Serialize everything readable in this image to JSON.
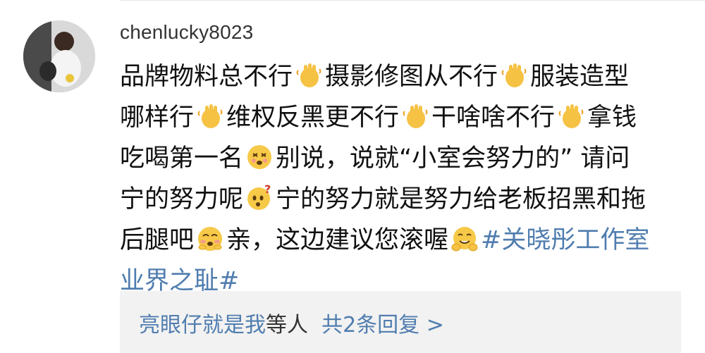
{
  "comment": {
    "username": "chenlucky8023",
    "lines": [
      [
        "品牌物料总不行",
        "摄影修图从不行",
        "服装造型"
      ],
      [
        "哪样行",
        "维权反黑更不行",
        "干啥啥不行",
        "拿钱"
      ],
      [
        "吃喝第一名",
        "别说，说就“小室会努力的” 请问"
      ],
      [
        "宁的努力呢",
        "宁的努力就是努力给老板招黑和拖"
      ],
      [
        "后腿吧",
        "亲，这边建议您滚喔",
        "#关晓彤工作室"
      ],
      [
        "业界之耻#"
      ]
    ]
  },
  "emojis": {
    "clap": "waving-hand-icon",
    "dizzy": "dizzy-face-icon",
    "question": "thinking-face-icon",
    "shy": "flushed-face-icon",
    "hug": "hugging-face-icon"
  },
  "replies": {
    "preview_user": "亮眼仔就是我",
    "others_text": "等人",
    "count_text": "共2条回复 >"
  },
  "colors": {
    "link": "#507daf",
    "text": "#111111",
    "username": "#333333",
    "reply_bg": "#f2f2f2"
  }
}
